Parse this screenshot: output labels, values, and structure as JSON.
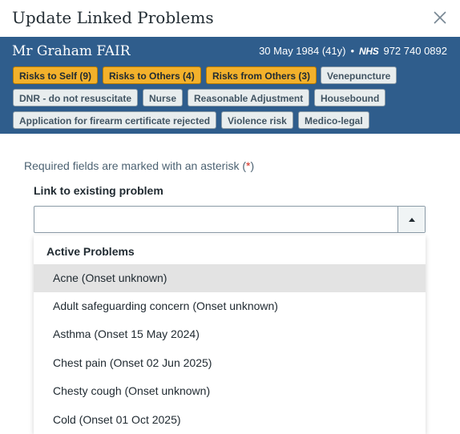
{
  "modal": {
    "title": "Update Linked Problems"
  },
  "patient": {
    "name": "Mr Graham FAIR",
    "dob": "30 May 1984 (41y)",
    "separator": "•",
    "nhs_label": "NHS",
    "nhs_number": "972 740 0892"
  },
  "flags": [
    {
      "label": "Risks to Self (9)",
      "kind": "risk"
    },
    {
      "label": "Risks to Others (4)",
      "kind": "risk"
    },
    {
      "label": "Risks from Others (3)",
      "kind": "risk"
    },
    {
      "label": "Venepuncture",
      "kind": "plain"
    },
    {
      "label": "DNR - do not resuscitate",
      "kind": "plain"
    },
    {
      "label": "Nurse",
      "kind": "plain"
    },
    {
      "label": "Reasonable Adjustment",
      "kind": "plain"
    },
    {
      "label": "Housebound",
      "kind": "plain"
    },
    {
      "label": "Application for firearm certificate rejected",
      "kind": "plain"
    },
    {
      "label": "Violence risk",
      "kind": "plain"
    },
    {
      "label": "Medico-legal",
      "kind": "plain"
    }
  ],
  "form": {
    "required_note_prefix": "Required fields are marked with an asterisk (",
    "required_asterisk": "*",
    "required_note_suffix": ")",
    "link_label": "Link to existing problem",
    "link_value": "",
    "group_label": "Active Problems",
    "options": [
      "Acne (Onset unknown)",
      "Adult safeguarding concern (Onset unknown)",
      "Asthma (Onset 15 May 2024)",
      "Chest pain (Onset 02 Jun 2025)",
      "Chesty cough (Onset unknown)",
      "Cold (Onset 01 Oct 2025)"
    ],
    "highlighted_option": "Acne (Onset unknown)"
  },
  "colors": {
    "banner": "#2f5d8c",
    "risk_flag": "#f3b12b",
    "plain_flag": "#e8edee",
    "asterisk": "#d5281b",
    "highlight": "#e3e3e3"
  }
}
